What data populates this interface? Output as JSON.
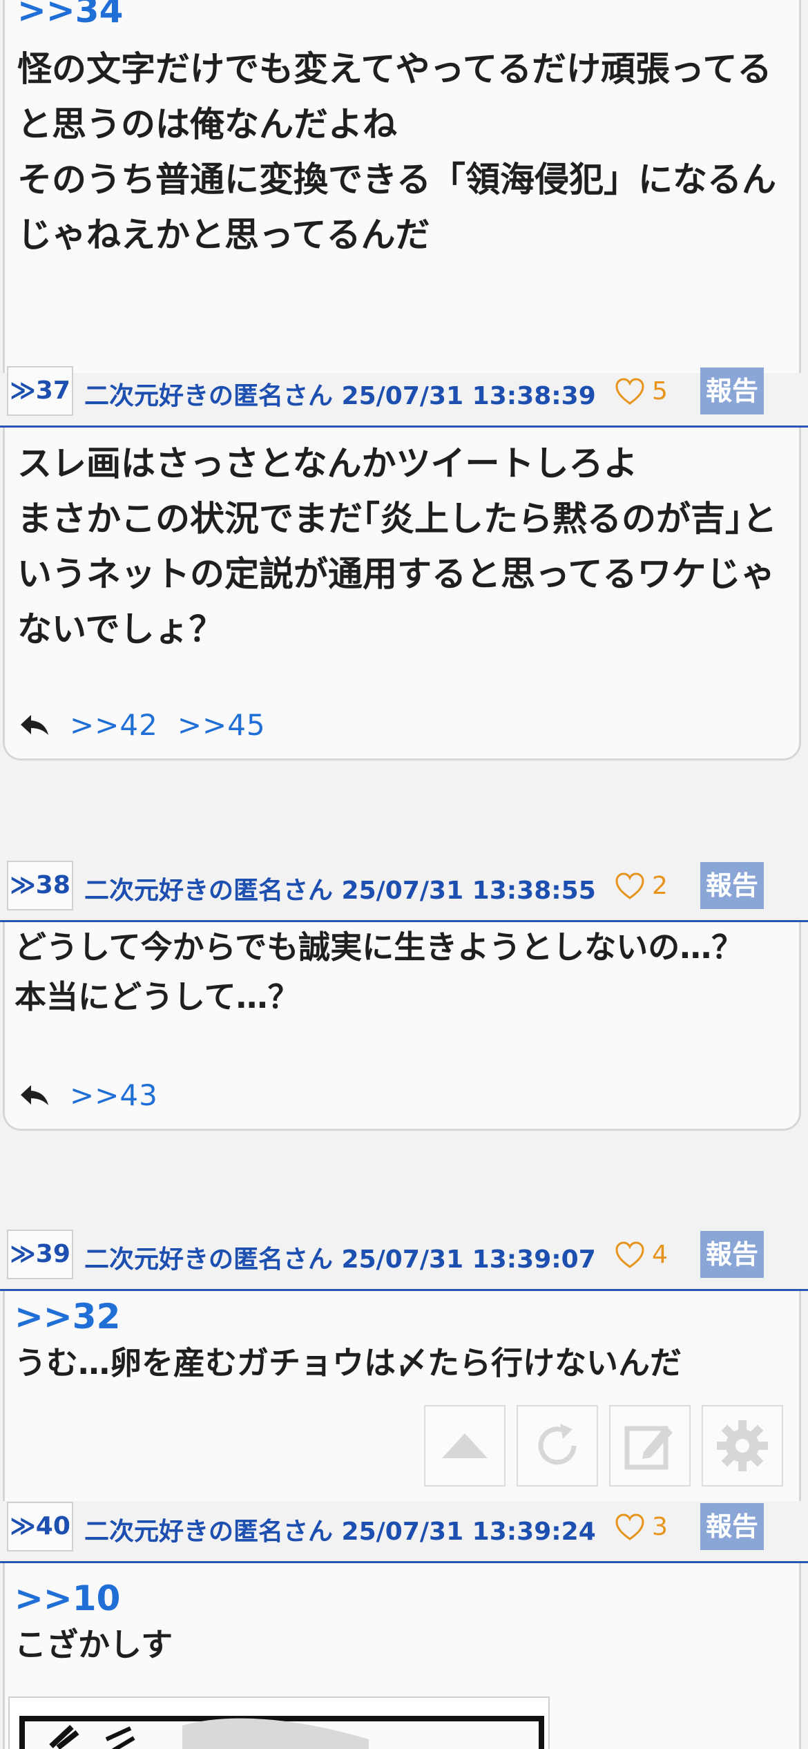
{
  "posts": [
    {
      "anchor": ">>34",
      "body": "怪の文字だけでも変えてやってるだけ頑張ってると思うのは俺なんだよね\nそのうち普通に変換できる「領海侵犯」になるんじゃねえかと思ってるんだ"
    },
    {
      "num": "≫37",
      "meta": "二次元好きの匿名さん 25/07/31 13:38:39",
      "likes": "5",
      "report": "報告",
      "body": "スレ画はさっさとなんかツイートしろよ\nまさかこの状況でまだ｢炎上したら黙るのが吉｣というネットの定説が通用すると思ってるワケじゃないでしょ？",
      "replies": [
        ">>42",
        ">>45"
      ]
    },
    {
      "num": "≫38",
      "meta": "二次元好きの匿名さん 25/07/31 13:38:55",
      "likes": "2",
      "report": "報告",
      "body": "どうして今からでも誠実に生きようとしないの…？\n本当にどうして…？",
      "replies": [
        ">>43"
      ]
    },
    {
      "num": "≫39",
      "meta": "二次元好きの匿名さん 25/07/31 13:39:07",
      "likes": "4",
      "report": "報告",
      "anchor": ">>32",
      "body": "うむ…卵を産むガチョウは〆たら行けないんだ"
    },
    {
      "num": "≫40",
      "meta": "二次元好きの匿名さん 25/07/31 13:39:24",
      "likes": "3",
      "report": "報告",
      "anchor": ">>10",
      "body": "こざかしす"
    }
  ],
  "toolbar": {
    "icons": [
      "scroll-top-icon",
      "reload-icon",
      "compose-icon",
      "settings-icon"
    ]
  },
  "colors": {
    "link": "#1f6fd6",
    "meta": "#1c4fb0",
    "like": "#e7941c",
    "report_bg": "#8aa6d6",
    "divider": "#2a56b3"
  }
}
